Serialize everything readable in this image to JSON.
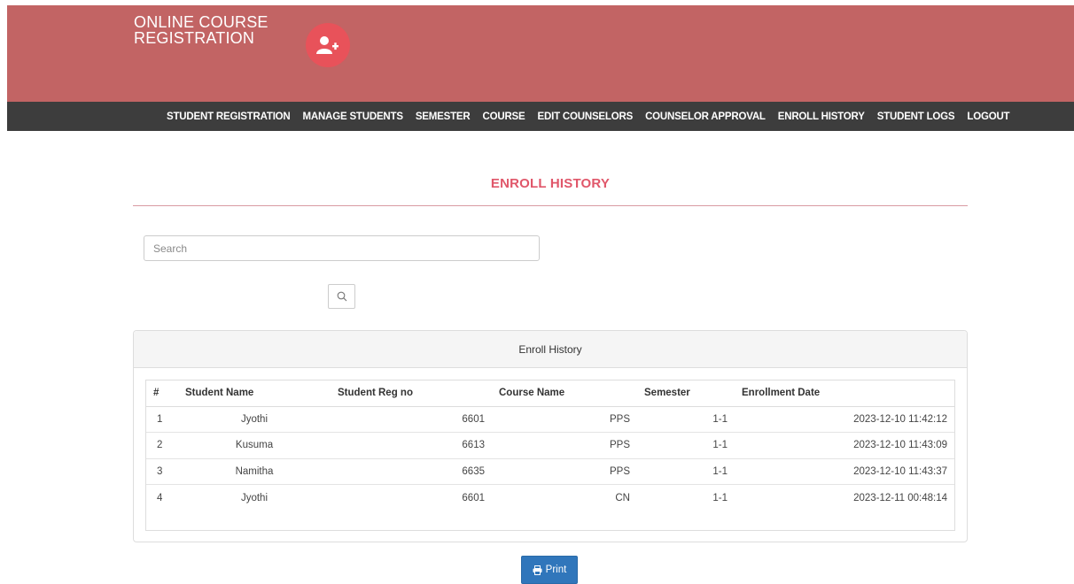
{
  "header": {
    "brand_line1": "ONLINE COURSE",
    "brand_line2": "REGISTRATION",
    "logo_icon": "add-user-icon",
    "colors": {
      "header_bg": "#c26464",
      "logo_bg": "#e8525a",
      "navbar_bg": "#3d3d3d"
    }
  },
  "nav": {
    "items": [
      {
        "label": "STUDENT REGISTRATION"
      },
      {
        "label": "MANAGE STUDENTS"
      },
      {
        "label": "SEMESTER"
      },
      {
        "label": "COURSE"
      },
      {
        "label": "EDIT COUNSELORS"
      },
      {
        "label": "COUNSELOR APPROVAL"
      },
      {
        "label": "ENROLL HISTORY"
      },
      {
        "label": "STUDENT LOGS"
      },
      {
        "label": "LOGOUT"
      }
    ]
  },
  "main": {
    "title": "ENROLL HISTORY",
    "title_color": "#e0576a",
    "search": {
      "placeholder": "Search",
      "value": "",
      "button_icon": "search-icon"
    },
    "panel": {
      "heading": "Enroll History",
      "columns": [
        "#",
        "Student Name",
        "Student Reg no",
        "Course Name",
        "Semester",
        "Enrollment Date"
      ],
      "rows": [
        {
          "num": "1",
          "name": "Jyothi",
          "reg": "6601",
          "course": "PPS",
          "semester": "1-1",
          "date": "2023-12-10 11:42:12"
        },
        {
          "num": "2",
          "name": "Kusuma",
          "reg": "6613",
          "course": "PPS",
          "semester": "1-1",
          "date": "2023-12-10 11:43:09"
        },
        {
          "num": "3",
          "name": "Namitha",
          "reg": "6635",
          "course": "PPS",
          "semester": "1-1",
          "date": "2023-12-10 11:43:37"
        },
        {
          "num": "4",
          "name": "Jyothi",
          "reg": "6601",
          "course": "CN",
          "semester": "1-1",
          "date": "2023-12-11 00:48:14"
        }
      ]
    },
    "print_button": {
      "label": "Print",
      "icon": "print-icon",
      "color": "#3076bb"
    }
  }
}
